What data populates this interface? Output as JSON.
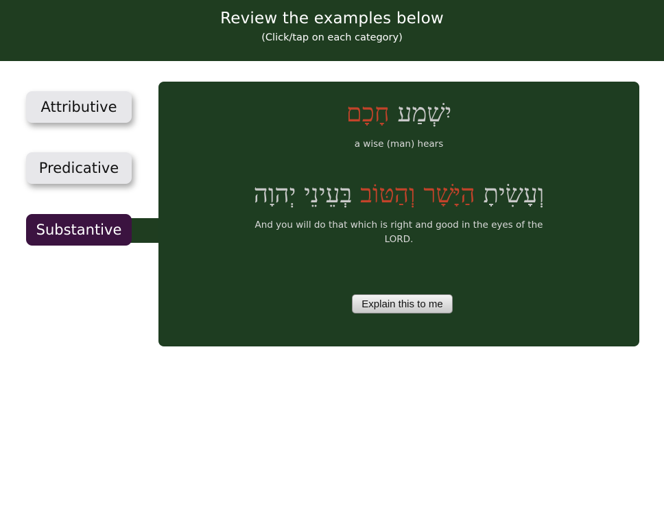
{
  "header": {
    "title": "Review the examples below",
    "subtitle": "(Click/tap on each category)"
  },
  "tabs": [
    {
      "label": "Attributive",
      "active": false
    },
    {
      "label": "Predicative",
      "active": false
    },
    {
      "label": "Substantive",
      "active": true
    }
  ],
  "examples": [
    {
      "hebrew_highlight": "חָכָם",
      "hebrew_rest": "יִשְׁמַע",
      "translation": "a wise (man) hears"
    },
    {
      "hebrew_before": "וְעָשִׂיתָ",
      "hebrew_highlight": "הַיָּשָׁר וְהַטּוֹב",
      "hebrew_after": "בְּעֵינֵי יְהוָה",
      "translation": "And you will do that which is right and good in the eyes of the LORD."
    }
  ],
  "explain_button": "Explain this to me",
  "colors": {
    "header_bg": "#1f3d20",
    "panel_bg": "#1e3d21",
    "active_tab": "#3b1340",
    "inactive_tab": "#e7e7ea",
    "highlight": "#c2432a"
  }
}
